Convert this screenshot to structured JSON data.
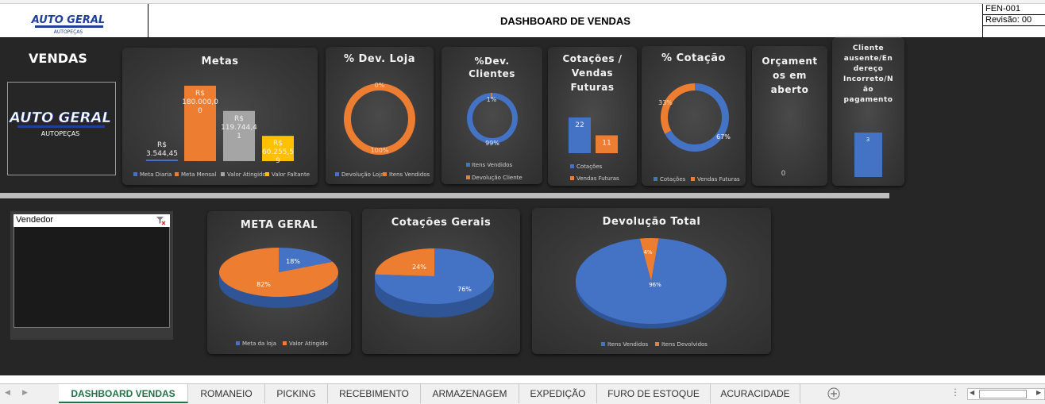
{
  "header": {
    "title": "DASHBOARD DE VENDAS",
    "code": "FEN-001",
    "revision": "Revisão: 00",
    "logo_main": "AUTO GERAL",
    "logo_sub": "AUTOPEÇAS"
  },
  "sidebar": {
    "title": "VENDAS",
    "slicer_label": "Vendedor"
  },
  "panels": {
    "metas": {
      "title": "Metas",
      "bars": [
        {
          "label": "R$\n3.544,45",
          "value": 3544.45,
          "color": "#4472c4"
        },
        {
          "label": "R$\n180.000,0\n0",
          "value": 180000,
          "color": "#ed7d31"
        },
        {
          "label": "R$\n119.744,4\n1",
          "value": 119744.41,
          "color": "#a5a5a5"
        },
        {
          "label": "R$\n60.255,5\n9",
          "value": 60255.59,
          "color": "#ffc000"
        }
      ],
      "legend": [
        "Meta Diaria",
        "Meta Mensal",
        "Valor Atingido",
        "Valor Faltante"
      ]
    },
    "dev_loja": {
      "title": "% Dev. Loja",
      "values": [
        0,
        100
      ],
      "labels": [
        "0%",
        "100%"
      ],
      "legend": [
        "Devolução Loja",
        "Itens Vendidos"
      ]
    },
    "dev_clientes": {
      "title_1": "%Dev.",
      "title_2": "Clientes",
      "values": [
        99,
        1
      ],
      "labels": [
        "99%",
        "1%"
      ],
      "legend": [
        "Itens Vendidos",
        "Devolução Cliente"
      ]
    },
    "cotacoes_vendas": {
      "title_1": "Cotações /",
      "title_2": "Vendas",
      "title_3": "Futuras",
      "values": [
        22,
        11
      ],
      "labels": [
        "22",
        "11"
      ],
      "legend": [
        "Cotações",
        "Vendas Futuras"
      ]
    },
    "pct_cotacao": {
      "title": "% Cotação",
      "values": [
        67,
        33
      ],
      "labels": [
        "67%",
        "33%"
      ],
      "legend": [
        "Cotações",
        "Vendas Futuras"
      ]
    },
    "orcamentos": {
      "title_1": "Orçament",
      "title_2": "os em",
      "title_3": "aberto",
      "value": "0"
    },
    "cliente_ausente": {
      "title_1": "Cliente",
      "title_2": "ausente/En",
      "title_3": "dereço",
      "title_4": "Incorreto/N",
      "title_5": "ão",
      "title_6": "pagamento",
      "value": 3,
      "label": "3"
    },
    "meta_geral": {
      "title": "META GERAL",
      "values": [
        18,
        82
      ],
      "labels": [
        "18%",
        "82%"
      ],
      "legend": [
        "Meta da loja",
        "Valor Atingido"
      ]
    },
    "cotacoes_gerais": {
      "title": "Cotações Gerais",
      "values": [
        76,
        24
      ],
      "labels": [
        "76%",
        "24%"
      ]
    },
    "devolucao_total": {
      "title": "Devolução Total",
      "values": [
        96,
        4
      ],
      "labels": [
        "96%",
        "4%"
      ],
      "legend": [
        "Itens Vendidos",
        "Itens Devolvidos"
      ]
    }
  },
  "colors": {
    "blue": "#4472c4",
    "orange": "#ed7d31",
    "gray": "#a5a5a5",
    "yellow": "#ffc000",
    "excel_green": "#217346"
  },
  "tabs": [
    "DASHBOARD VENDAS",
    "ROMANEIO",
    "PICKING",
    "RECEBIMENTO",
    "ARMAZENAGEM",
    "EXPEDIÇÃO",
    "FURO DE ESTOQUE",
    "ACURACIDADE"
  ],
  "chart_data": [
    {
      "type": "bar",
      "title": "Metas",
      "categories": [
        "Meta Diaria",
        "Meta Mensal",
        "Valor Atingido",
        "Valor Faltante"
      ],
      "values": [
        3544.45,
        180000,
        119744.41,
        60255.59
      ]
    },
    {
      "type": "pie",
      "title": "% Dev. Loja",
      "categories": [
        "Devolução Loja",
        "Itens Vendidos"
      ],
      "values": [
        0,
        100
      ]
    },
    {
      "type": "pie",
      "title": "%Dev. Clientes",
      "categories": [
        "Itens Vendidos",
        "Devolução Cliente"
      ],
      "values": [
        99,
        1
      ]
    },
    {
      "type": "bar",
      "title": "Cotações / Vendas Futuras",
      "categories": [
        "Cotações",
        "Vendas Futuras"
      ],
      "values": [
        22,
        11
      ]
    },
    {
      "type": "pie",
      "title": "% Cotação",
      "categories": [
        "Cotações",
        "Vendas Futuras"
      ],
      "values": [
        67,
        33
      ]
    },
    {
      "type": "bar",
      "title": "Cliente ausente/Endereço Incorreto/Não pagamento",
      "categories": [
        ""
      ],
      "values": [
        3
      ]
    },
    {
      "type": "pie",
      "title": "META GERAL",
      "categories": [
        "Meta da loja",
        "Valor Atingido"
      ],
      "values": [
        18,
        82
      ]
    },
    {
      "type": "pie",
      "title": "Cotações Gerais",
      "categories": [
        "",
        ""
      ],
      "values": [
        76,
        24
      ]
    },
    {
      "type": "pie",
      "title": "Devolução Total",
      "categories": [
        "Itens Vendidos",
        "Itens Devolvidos"
      ],
      "values": [
        96,
        4
      ]
    }
  ]
}
